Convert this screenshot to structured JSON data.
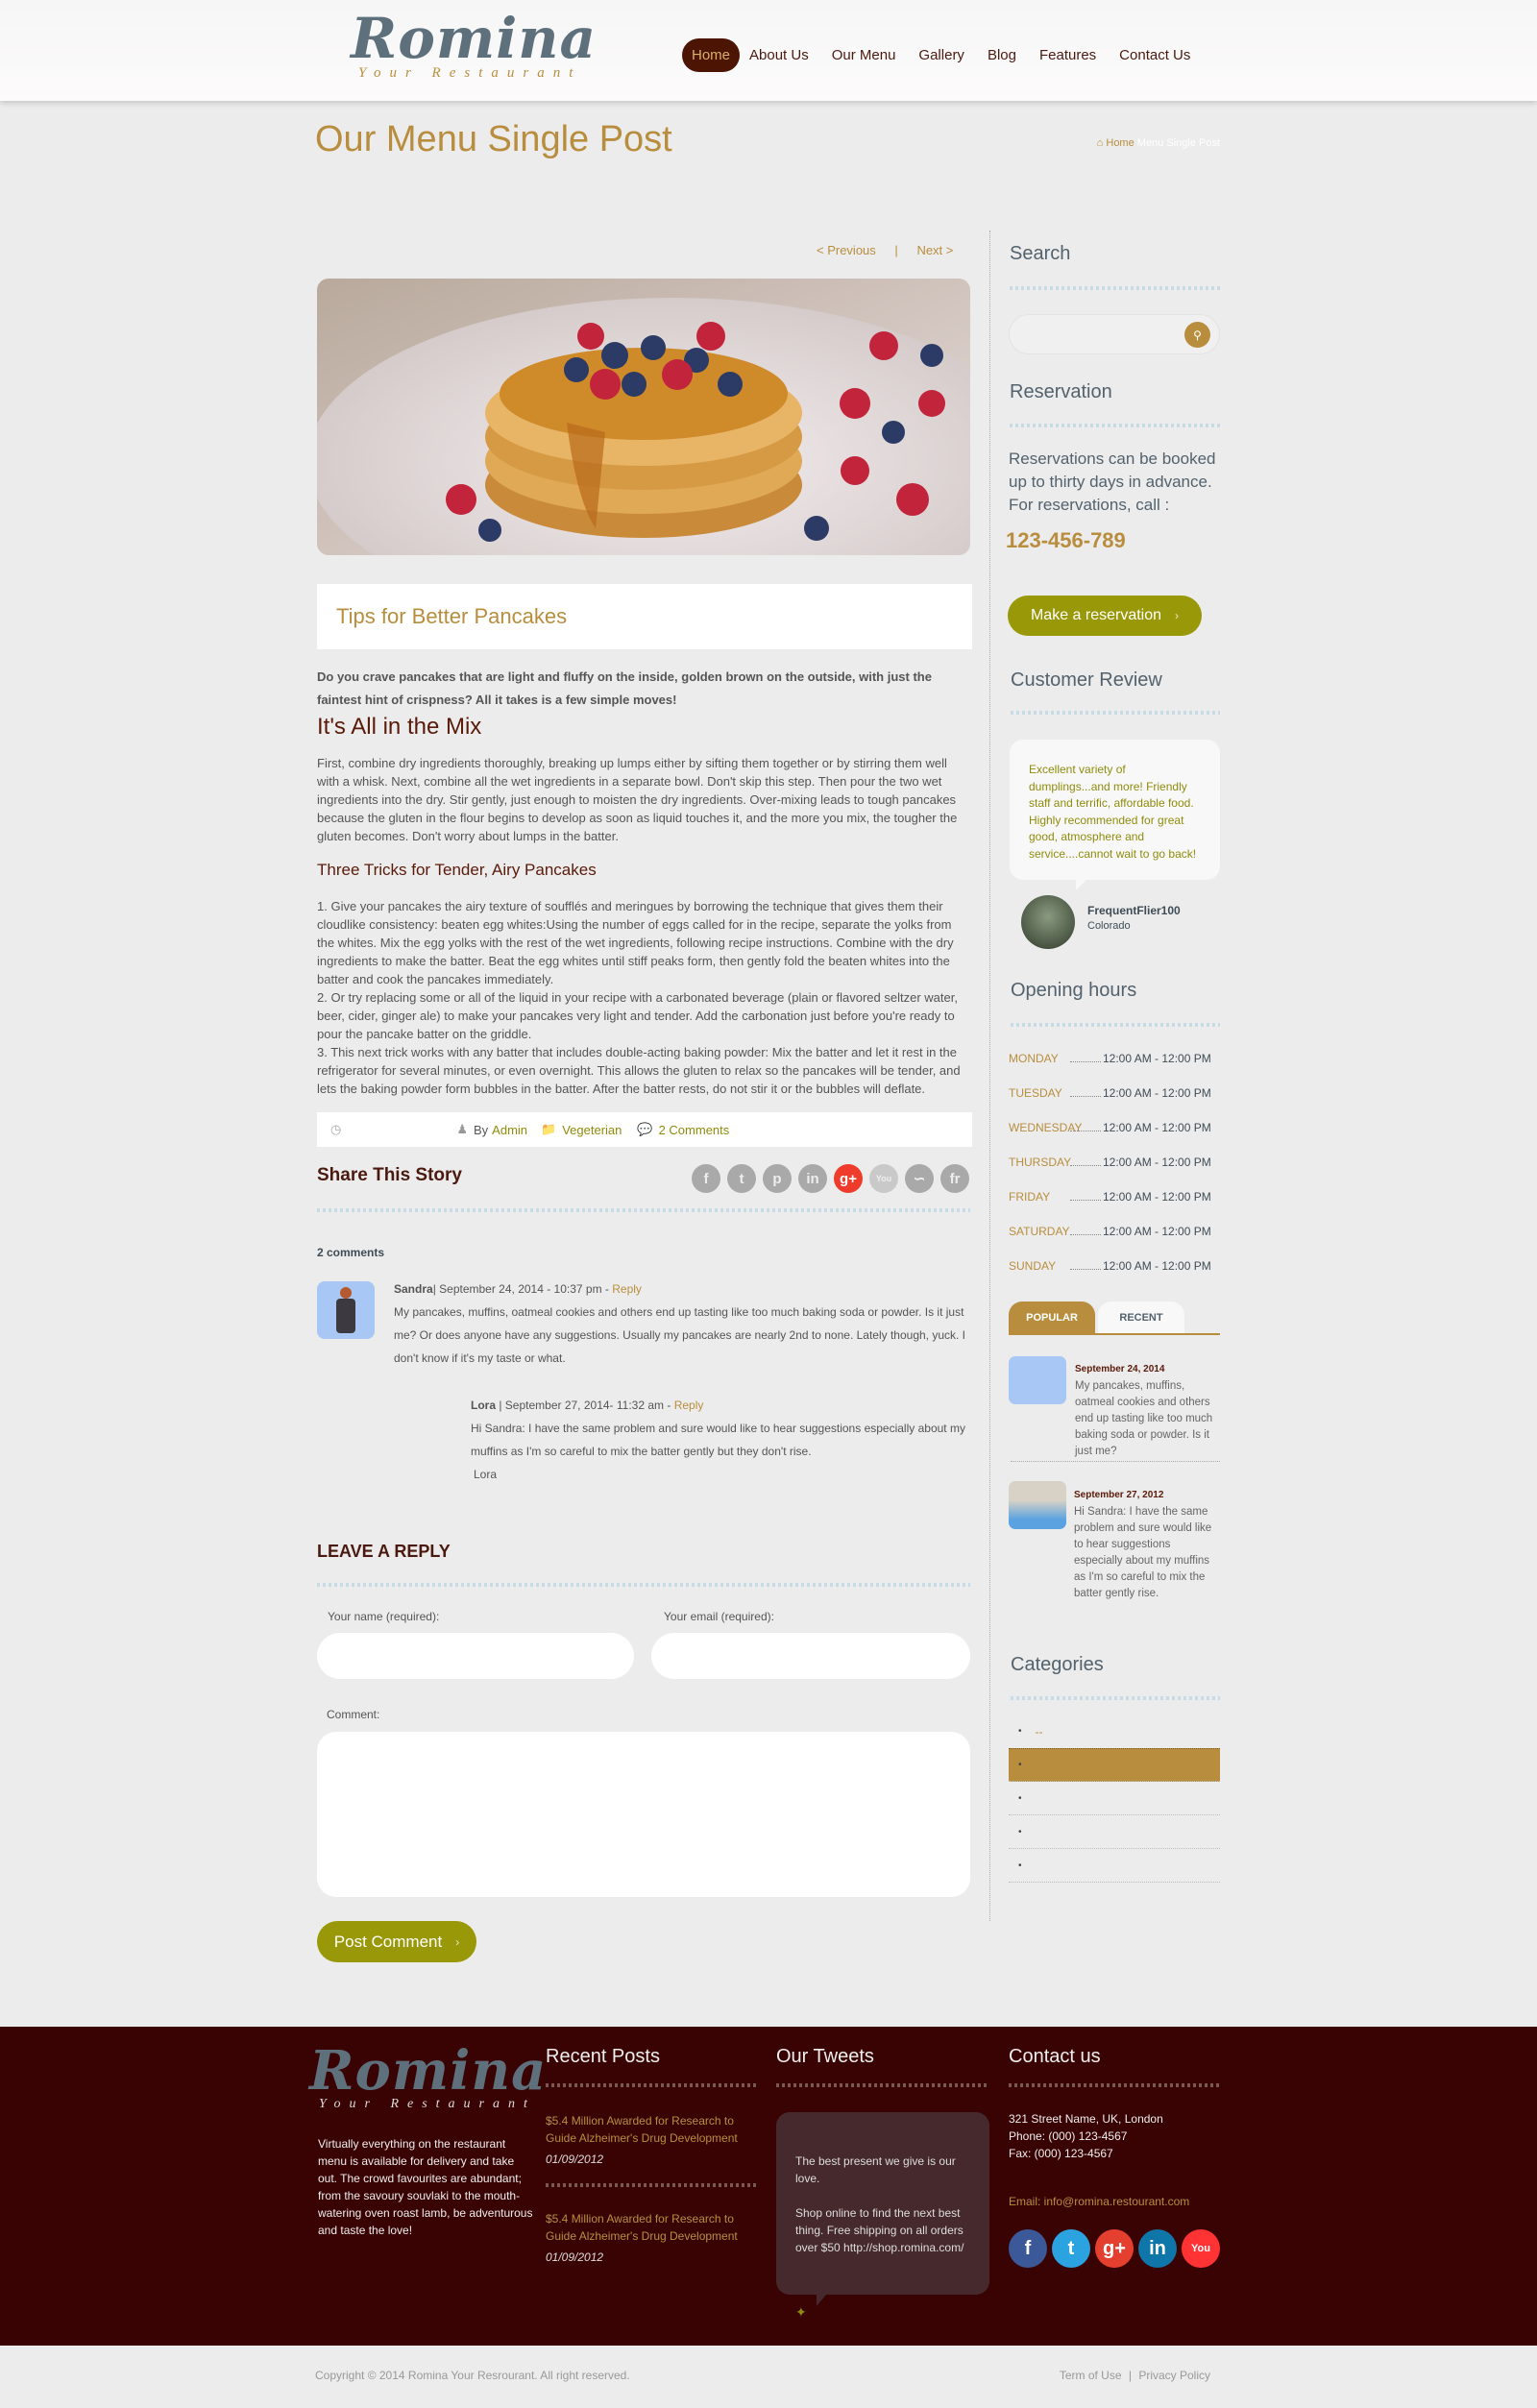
{
  "header": {
    "logo_title": "Romina",
    "logo_subtitle": "Your Restaurant",
    "nav": [
      "Home",
      "About Us",
      "Our Menu",
      "Gallery",
      "Blog",
      "Features",
      "Contact Us"
    ],
    "active_nav": "Home"
  },
  "page": {
    "title": "Our Menu Single Post",
    "breadcrumb": {
      "home": "Home",
      "current": "Menu Single Post"
    }
  },
  "post": {
    "prev": "< Previous",
    "separator": "|",
    "next": "Next >",
    "title": "Tips for Better Pancakes",
    "intro": "Do you crave pancakes that are light and fluffy on the inside, golden brown on the outside, with just the faintest hint of crispness? All it takes is a few simple moves!",
    "h2": "It's All in the Mix",
    "paragraph": "First, combine dry ingredients thoroughly, breaking up lumps either by sifting them together or by stirring them well with a whisk.  Next, combine all the wet ingredients in a separate bowl. Don't skip this step.  Then pour the two wet ingredients into the dry. Stir gently, just enough to moisten the dry ingredients. Over-mixing leads to tough pancakes  because the gluten in the flour begins to develop as soon as liquid touches it, and the more you mix, the tougher the gluten becomes. Don't worry about lumps in the batter.",
    "h3": "Three Tricks for Tender, Airy Pancakes",
    "tricks": [
      "1. Give your pancakes the airy texture of soufflés and meringues by borrowing the technique that gives them their cloudlike consistency: beaten egg whites:Using the number of eggs called for in the recipe, separate the yolks from the whites. Mix the egg yolks with the rest of the wet ingredients, following recipe instructions. Combine with the dry  ingredients to make the batter. Beat the egg whites until stiff peaks form, then gently fold the beaten whites into the batter and cook the pancakes immediately.",
      "2. Or try replacing some or all of the liquid in your recipe with a carbonated beverage (plain or flavored seltzer water,  beer, cider, ginger ale) to make your pancakes very light and tender. Add the carbonation just before you're ready to pour the pancake batter on the griddle.",
      "3. This next trick works with any batter that includes double-acting baking powder: Mix the batter and let it rest in the  refrigerator for several minutes, or even overnight. This allows the gluten to relax so the pancakes will be tender, and lets the baking powder form bubbles in the batter. After the batter rests, do not stir it or the bubbles will deflate."
    ],
    "meta": {
      "by": "By",
      "author": "Admin",
      "category": "Vegeterian",
      "comments": "2 Comments"
    },
    "share_title": "Share This Story",
    "share_icons": [
      "facebook-icon",
      "twitter-icon",
      "pinterest-icon",
      "linkedin-icon",
      "googleplus-icon",
      "youtube-icon",
      "rss-icon",
      "friendfeed-icon"
    ]
  },
  "comments": {
    "count_label": "2 comments",
    "items": [
      {
        "author": "Sandra",
        "date": "| September 24, 2014 - 10:37 pm - ",
        "reply": "Reply",
        "text": "My pancakes, muffins, oatmeal cookies and others end up tasting like too much baking soda or powder. Is it just me? Or does anyone have any suggestions. Usually my pancakes are nearly 2nd to none. Lately though, yuck. I don't know if it's my taste or what."
      },
      {
        "author": "Lora",
        "date": " | September 27, 2014- 11:32 am - ",
        "reply": "Reply",
        "text": "Hi Sandra: I have the same problem and sure would like to hear suggestions especially about my muffins as I'm so careful to mix the batter gently but they don't rise.",
        "signature": "Lora"
      }
    ]
  },
  "reply_form": {
    "title": "LEAVE A REPLY",
    "name_label": "Your name (required):",
    "email_label": "Your email (required):",
    "comment_label": "Comment:",
    "name_value": "",
    "email_value": "",
    "comment_value": "",
    "submit": "Post Comment",
    "chevron": "›"
  },
  "sidebar": {
    "search_title": "Search",
    "search_placeholder": "",
    "reservation_title": "Reservation",
    "reservation_text": "Reservations can be booked up to thirty days in advance. For reservations, call :",
    "phone": "123-456-789",
    "reservation_button": "Make a reservation",
    "review_title": "Customer Review",
    "review_text": "Excellent variety of dumplings...and more! Friendly staff and terrific, affordable food. Highly recommended for great good, atmosphere and service....cannot wait to go back!",
    "reviewer_name": "FrequentFlier100",
    "reviewer_location": "Colorado",
    "hours_title": "Opening hours",
    "hours": [
      {
        "day": "MONDAY",
        "time": "12:00 AM - 12:00 PM"
      },
      {
        "day": "TUESDAY",
        "time": "12:00 AM - 12:00 PM"
      },
      {
        "day": "WEDNESDAY",
        "time": "12:00 AM - 12:00 PM"
      },
      {
        "day": "THURSDAY",
        "time": "12:00 AM - 12:00 PM"
      },
      {
        "day": "FRIDAY",
        "time": "12:00 AM - 12:00 PM"
      },
      {
        "day": "SATURDAY",
        "time": "12:00 AM - 12:00 PM"
      },
      {
        "day": "SUNDAY",
        "time": "12:00 AM - 12:00 PM"
      }
    ],
    "tabs": [
      "POPULAR",
      "RECENT"
    ],
    "active_tab": "POPULAR",
    "tab_posts": [
      {
        "date": "September 24, 2014",
        "text": "My pancakes, muffins, oatmeal cookies and others end up tasting like too much baking soda or powder. Is it just me?"
      },
      {
        "date": "September 27, 2012",
        "text": "Hi Sandra: I have the same problem and sure would like to hear suggestions especially about my muffins as I'm so careful to mix the batter gently rise."
      }
    ],
    "categories_title": "Categories",
    "categories": [
      "--",
      "",
      "",
      "",
      ""
    ]
  },
  "footer": {
    "logo_title": "Romina",
    "logo_subtitle": "Your Restaurant",
    "about": "Virtually everything on the restaurant menu is available for delivery and take out. The crowd favourites are abundant; from the savoury souvlaki to the mouth-watering oven roast lamb, be adventurous and taste the love!",
    "recent_title": "Recent Posts",
    "recent_posts": [
      {
        "title": "$5.4 Million Awarded for Research to Guide Alzheimer's Drug Development",
        "date": "01/09/2012"
      },
      {
        "title": "$5.4 Million Awarded for Research to Guide Alzheimer's Drug Development",
        "date": "01/09/2012"
      }
    ],
    "tweets_title": "Our Tweets",
    "tweets": [
      "The best present we give is our love.",
      "Shop online to find the next best thing. Free shipping on all orders over $50 http://shop.romina.com/"
    ],
    "contact_title": "Contact us",
    "address": "321 Street Name, UK, London",
    "phone": "Phone: (000) 123-4567",
    "fax": "Fax: (000) 123-4567",
    "email": "Email: info@romina.restourant.com",
    "social": [
      {
        "icon": "facebook-icon",
        "glyph": "f",
        "color": "#3b5998"
      },
      {
        "icon": "twitter-icon",
        "glyph": "t",
        "color": "#2aa3e0"
      },
      {
        "icon": "googleplus-icon",
        "glyph": "g+",
        "color": "#e5402f"
      },
      {
        "icon": "linkedin-icon",
        "glyph": "in",
        "color": "#0e76a8"
      },
      {
        "icon": "youtube-icon",
        "glyph": "You",
        "color": "#f33"
      }
    ],
    "copyright": "Copyright © 2014 Romina Your Resrourant. All right reserved.",
    "links": [
      "Term of Use",
      "Privacy Policy"
    ],
    "link_separator": "|"
  }
}
